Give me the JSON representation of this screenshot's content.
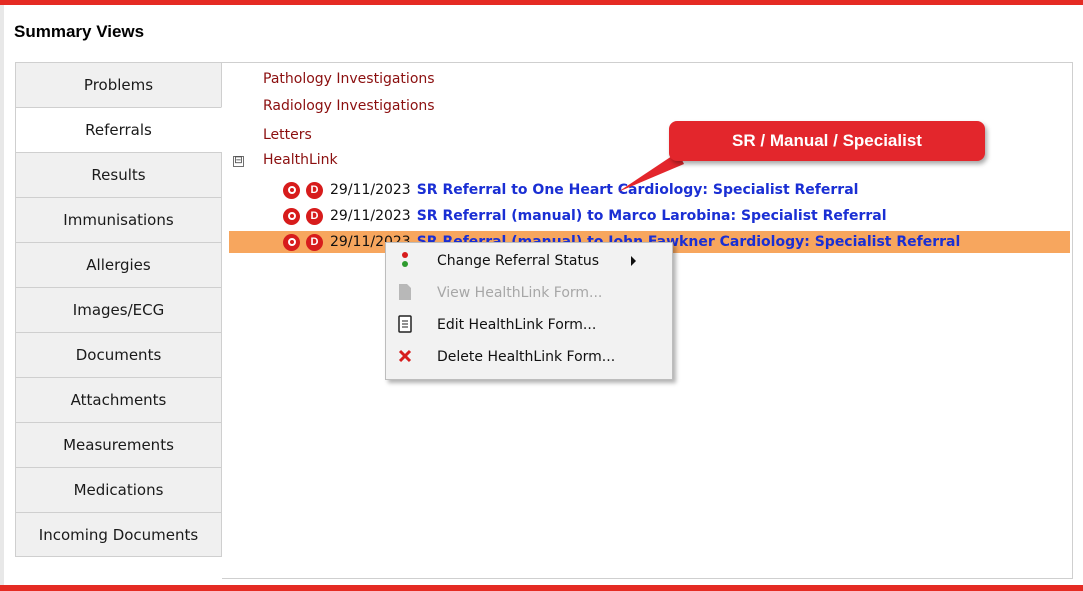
{
  "window": {
    "title": "Summary Views"
  },
  "tabs": [
    {
      "label": "Problems"
    },
    {
      "label": "Referrals"
    },
    {
      "label": "Results"
    },
    {
      "label": "Immunisations"
    },
    {
      "label": "Allergies"
    },
    {
      "label": "Images/ECG"
    },
    {
      "label": "Documents"
    },
    {
      "label": "Attachments"
    },
    {
      "label": "Measurements"
    },
    {
      "label": "Medications"
    },
    {
      "label": "Incoming Documents"
    }
  ],
  "active_tab": "Referrals",
  "tree": {
    "pathology": "Pathology Investigations",
    "radiology": "Radiology Investigations",
    "letters": "Letters",
    "expander": "⊟",
    "healthlink": "HealthLink",
    "referrals": [
      {
        "date": "29/11/2023",
        "text": "SR Referral to One Heart Cardiology: Specialist Referral",
        "status_icon": "referral-status-icon",
        "doc_icon": "D"
      },
      {
        "date": "29/11/2023",
        "text": "SR Referral (manual) to Marco Larobina: Specialist Referral",
        "status_icon": "referral-status-icon",
        "doc_icon": "D"
      },
      {
        "date": "29/11/2023",
        "text": "SR Referral (manual) to John Fawkner Cardiology: Specialist Referral",
        "status_icon": "referral-status-icon",
        "doc_icon": "D",
        "selected": true
      }
    ]
  },
  "callout": {
    "text": "SR / Manual / Specialist"
  },
  "context_menu": {
    "items": [
      {
        "label": "Change Referral Status",
        "icon": "traffic-light-icon",
        "enabled": true,
        "submenu": true
      },
      {
        "label": "View HealthLink Form...",
        "icon": "document-icon",
        "enabled": false
      },
      {
        "label": "Edit HealthLink Form...",
        "icon": "form-icon",
        "enabled": true
      },
      {
        "label": "Delete HealthLink Form...",
        "icon": "delete-x-icon",
        "enabled": true
      }
    ]
  },
  "colors": {
    "accent_red": "#e52b23",
    "link_blue": "#1a2fd4",
    "tree_text": "#8b0f0f",
    "selection": "#f7a65e"
  }
}
